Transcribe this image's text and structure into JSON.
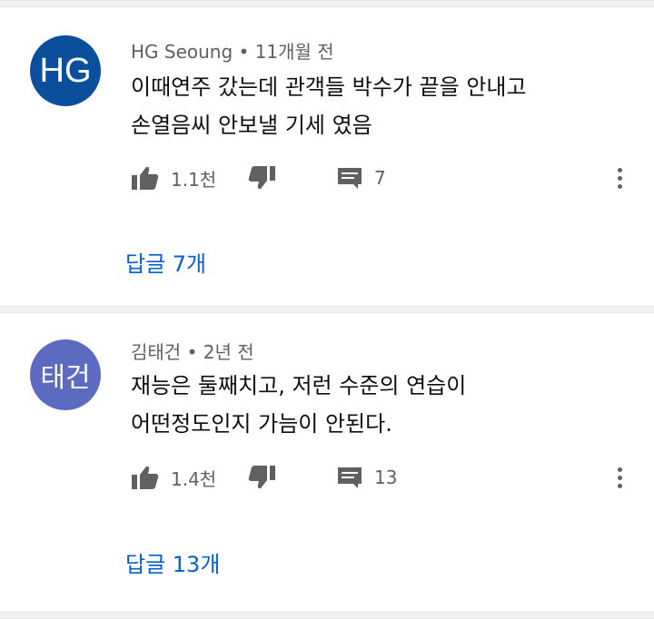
{
  "colors": {
    "avatar_1": "#0a4f9c",
    "avatar_2": "#5c6bc0",
    "link": "#065fd4"
  },
  "icons": [
    "thumb-up-icon",
    "thumb-down-icon",
    "reply-comment-icon",
    "more-vert-icon"
  ],
  "comments": [
    {
      "avatar_text": "HG",
      "author": "HG Seoung",
      "time": "11개월 전",
      "line1": "이때연주 갔는데 관객들 박수가 끝을 안내고",
      "line2": "손열음씨 안보낼 기세 였음",
      "likes": "1.1천",
      "reply_count": "7",
      "replies_label": "답글 7개"
    },
    {
      "avatar_text": "태건",
      "author": "김태건",
      "time": "2년 전",
      "line1": "재능은 둘째치고, 저런 수준의 연습이",
      "line2": "어떤정도인지 가늠이 안된다.",
      "likes": "1.4천",
      "reply_count": "13",
      "replies_label": "답글 13개"
    }
  ]
}
